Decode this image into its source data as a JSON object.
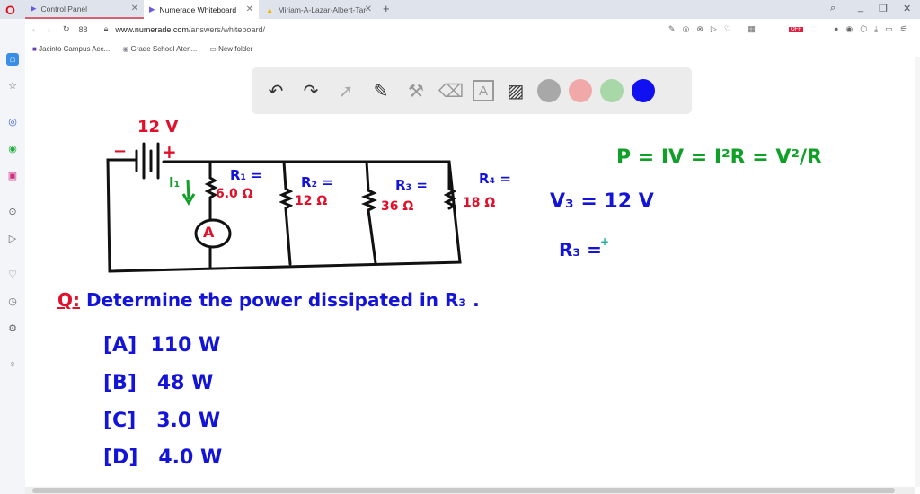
{
  "browser": {
    "tabs": [
      {
        "label": "Control Panel"
      },
      {
        "label": "Numerade Whiteboard"
      },
      {
        "label": "Miriam-A-Lazar-Albert-Tar"
      }
    ],
    "url_domain": "www.numerade.com",
    "url_path": "/answers/whiteboard/",
    "bookmarks": [
      {
        "label": "Jacinto Campus Acc..."
      },
      {
        "label": "Grade School Aten..."
      },
      {
        "label": "New folder"
      }
    ],
    "extension_badge": "OFF"
  },
  "toolbar": {
    "colors": [
      "#a8a8a8",
      "#f0a8a8",
      "#a8d8a8",
      "#1010f0"
    ]
  },
  "board": {
    "battery_voltage": "12 V",
    "minus": "−",
    "plus": "+",
    "current_label": "I₁",
    "ammeter": "A",
    "r1_label": "R₁ =",
    "r1_value": "6.0 Ω",
    "r2_label": "R₂ =",
    "r2_value": "12 Ω",
    "r3_label": "R₃ =",
    "r3_value": "36 Ω",
    "r4_label": "R₄ =",
    "r4_value": "18 Ω",
    "formula": "P = IV = I²R = V²/R",
    "v3": "V₃ = 12 V",
    "r3_eq": "R₃ =",
    "question_label": "Q:",
    "question": "Determine the power dissipated in R₃ .",
    "options": [
      {
        "key": "[A]",
        "value": "110 W"
      },
      {
        "key": "[B]",
        "value": "48 W"
      },
      {
        "key": "[C]",
        "value": "3.0 W"
      },
      {
        "key": "[D]",
        "value": "4.0 W"
      }
    ]
  }
}
